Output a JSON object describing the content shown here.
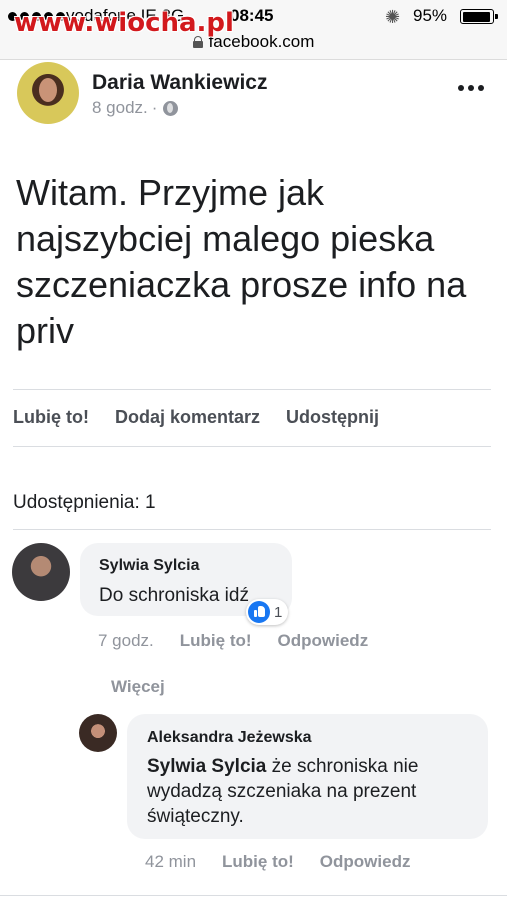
{
  "status_bar": {
    "carrier": "vodafone IE",
    "network": "3G",
    "time": "08:45",
    "battery": "95%",
    "url": "facebook.com",
    "watermark": "www.wiocha.pl"
  },
  "post": {
    "author": "Daria Wankiewicz",
    "time": "8 godz.",
    "separator": "·",
    "text": "Witam. Przyjme jak najszybciej malego pieska szczeniaczka prosze info na priv",
    "actions": {
      "like": "Lubię to!",
      "comment": "Dodaj komentarz",
      "share": "Udostępnij"
    },
    "shares_label": "Udostępnienia: 1"
  },
  "comments": [
    {
      "author": "Sylwia Sylcia",
      "text": "Do schroniska idź",
      "reaction_count": "1",
      "time": "7 godz.",
      "like": "Lubię to!",
      "reply": "Odpowiedz"
    }
  ],
  "more_replies": "Więcej",
  "reply": {
    "author": "Aleksandra Jeżewska",
    "mention": "Sylwia Sylcia",
    "text": " że schroniska nie wydadzą szczeniaka na prezent świąteczny.",
    "time": "42 min",
    "like": "Lubię to!",
    "reply": "Odpowiedz"
  },
  "colors": {
    "like_blue": "#1877f2",
    "watermark_red": "#d2191d",
    "meta_gray": "#90949c"
  }
}
